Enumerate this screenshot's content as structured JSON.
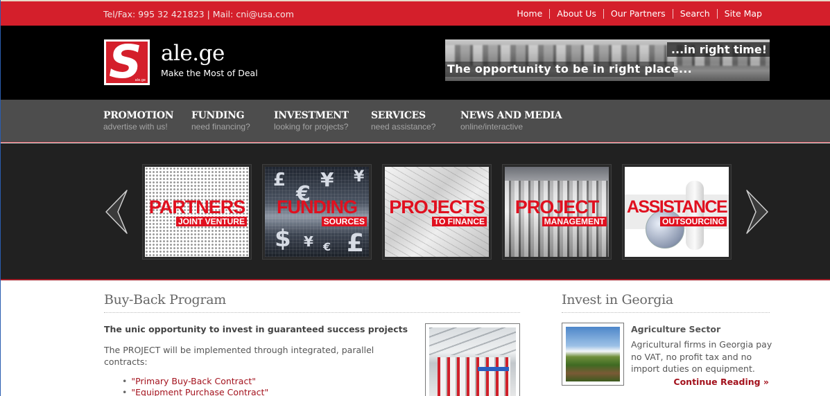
{
  "topbar": {
    "contact": "Tel/Fax: 995 32 421823 | Mail: cni@usa.com",
    "links": [
      "Home",
      "About Us",
      "Our Partners",
      "Search",
      "Site Map"
    ]
  },
  "header": {
    "logo_letter": "S",
    "logo_mini": "ale.ge",
    "site_name": "ale.ge",
    "tagline": "Make the Most of Deal",
    "banner": {
      "line1": "...in right time!",
      "line2": "The opportunity to be in right place..."
    }
  },
  "main_nav": [
    {
      "label": "PROMOTION",
      "sub": "advertise with us!"
    },
    {
      "label": "FUNDING",
      "sub": "need financing?"
    },
    {
      "label": "INVESTMENT",
      "sub": "looking for projects?"
    },
    {
      "label": "SERVICES",
      "sub": "need assistance?"
    },
    {
      "label": "NEWS AND MEDIA",
      "sub": "online/interactive"
    }
  ],
  "slider": {
    "prev_icon": "chevron-left-icon",
    "next_icon": "chevron-right-icon",
    "slides": [
      {
        "title": "PARTNERS",
        "subtitle": "JOINT VENTURE"
      },
      {
        "title": "FUNDING",
        "subtitle": "SOURCES"
      },
      {
        "title": "PROJECTS",
        "subtitle": "TO FINANCE"
      },
      {
        "title": "PROJECT",
        "subtitle": "MANAGEMENT"
      },
      {
        "title": "ASSISTANCE",
        "subtitle": "OUTSOURCING"
      }
    ],
    "currency_symbols": [
      "£",
      "€",
      "¥",
      "¥",
      "$",
      "¥",
      "€",
      "£"
    ]
  },
  "buyback": {
    "title": "Buy-Back Program",
    "lead": "The unic opportunity to invest in guaranteed success projects",
    "paragraph": "The PROJECT will be implemented through integrated, parallel contracts:",
    "items": [
      "\"Primary Buy-Back Contract\"",
      "\"Equipment Purchase Contract\""
    ]
  },
  "invest": {
    "title": "Invest in Georgia",
    "subheading": "Agriculture Sector",
    "text": "Agricultural firms in Georgia pay no VAT, no profit tax and no import duties on equipment.",
    "more": "Continue Reading »"
  },
  "colors": {
    "brand_red": "#d41f2b",
    "link_red": "#a3121d",
    "nav_gray": "#4d4d4d",
    "slider_bg": "#212121"
  }
}
